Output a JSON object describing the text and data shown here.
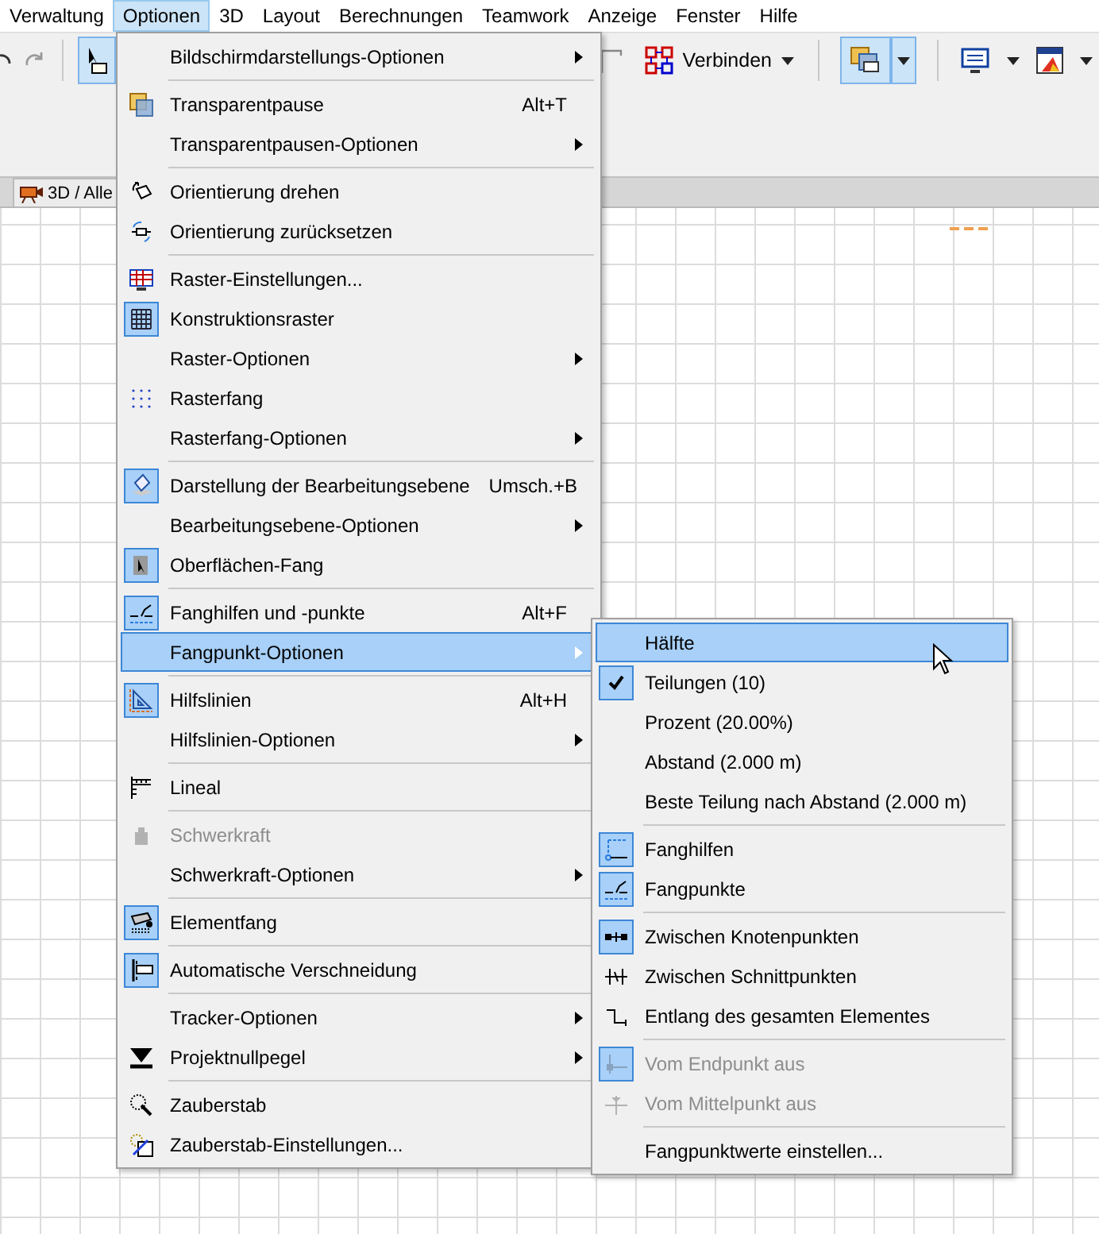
{
  "menubar": [
    {
      "label": "Verwaltung",
      "selected": false
    },
    {
      "label": "Optionen",
      "selected": true
    },
    {
      "label": "3D",
      "selected": false
    },
    {
      "label": "Layout",
      "selected": false
    },
    {
      "label": "Berechnungen",
      "selected": false
    },
    {
      "label": "Teamwork",
      "selected": false
    },
    {
      "label": "Anzeige",
      "selected": false
    },
    {
      "label": "Fenster",
      "selected": false
    },
    {
      "label": "Hilfe",
      "selected": false
    }
  ],
  "toolbar": {
    "connect_button": {
      "label": "Verbinden"
    }
  },
  "tab": {
    "label": "3D / Alle"
  },
  "menu": {
    "items": [
      {
        "kind": "item",
        "label": "Bildschirmdarstellungs-Optionen",
        "submenu": true,
        "checked": false,
        "disabled": false,
        "selected": false
      },
      {
        "kind": "separator"
      },
      {
        "kind": "item",
        "label": "Transparentpause",
        "shortcut": "Alt+T",
        "checked": false,
        "disabled": false,
        "selected": false
      },
      {
        "kind": "item",
        "label": "Transparentpausen-Optionen",
        "submenu": true,
        "checked": false,
        "disabled": false,
        "selected": false
      },
      {
        "kind": "separator"
      },
      {
        "kind": "item",
        "label": "Orientierung drehen",
        "checked": false,
        "disabled": false,
        "selected": false
      },
      {
        "kind": "item",
        "label": "Orientierung zurücksetzen",
        "checked": false,
        "disabled": false,
        "selected": false
      },
      {
        "kind": "separator"
      },
      {
        "kind": "item",
        "label": "Raster-Einstellungen...",
        "checked": false,
        "disabled": false,
        "selected": false
      },
      {
        "kind": "item",
        "label": "Konstruktionsraster",
        "checked": true,
        "disabled": false,
        "selected": false
      },
      {
        "kind": "item",
        "label": "Raster-Optionen",
        "submenu": true,
        "checked": false,
        "disabled": false,
        "selected": false
      },
      {
        "kind": "item",
        "label": "Rasterfang",
        "checked": false,
        "disabled": false,
        "selected": false
      },
      {
        "kind": "item",
        "label": "Rasterfang-Optionen",
        "submenu": true,
        "checked": false,
        "disabled": false,
        "selected": false
      },
      {
        "kind": "separator"
      },
      {
        "kind": "item",
        "label": "Darstellung der Bearbeitungsebene",
        "shortcut": "Umsch.+B",
        "checked": true,
        "disabled": false,
        "selected": false
      },
      {
        "kind": "item",
        "label": "Bearbeitungsebene-Optionen",
        "submenu": true,
        "checked": false,
        "disabled": false,
        "selected": false
      },
      {
        "kind": "item",
        "label": "Oberflächen-Fang",
        "checked": true,
        "disabled": false,
        "selected": false
      },
      {
        "kind": "separator"
      },
      {
        "kind": "item",
        "label": "Fanghilfen und -punkte",
        "shortcut": "Alt+F",
        "checked": true,
        "disabled": false,
        "selected": false
      },
      {
        "kind": "item",
        "label": "Fangpunkt-Optionen",
        "submenu": true,
        "checked": false,
        "disabled": false,
        "selected": true
      },
      {
        "kind": "separator"
      },
      {
        "kind": "item",
        "label": "Hilfslinien",
        "shortcut": "Alt+H",
        "checked": true,
        "disabled": false,
        "selected": false
      },
      {
        "kind": "item",
        "label": "Hilfslinien-Optionen",
        "submenu": true,
        "checked": false,
        "disabled": false,
        "selected": false
      },
      {
        "kind": "separator"
      },
      {
        "kind": "item",
        "label": "Lineal",
        "checked": false,
        "disabled": false,
        "selected": false
      },
      {
        "kind": "separator"
      },
      {
        "kind": "item",
        "label": "Schwerkraft",
        "checked": false,
        "disabled": true,
        "selected": false
      },
      {
        "kind": "item",
        "label": "Schwerkraft-Optionen",
        "submenu": true,
        "checked": false,
        "disabled": false,
        "selected": false
      },
      {
        "kind": "separator"
      },
      {
        "kind": "item",
        "label": "Elementfang",
        "checked": true,
        "disabled": false,
        "selected": false
      },
      {
        "kind": "separator"
      },
      {
        "kind": "item",
        "label": "Automatische Verschneidung",
        "checked": true,
        "disabled": false,
        "selected": false
      },
      {
        "kind": "separator"
      },
      {
        "kind": "item",
        "label": "Tracker-Optionen",
        "submenu": true,
        "checked": false,
        "disabled": false,
        "selected": false
      },
      {
        "kind": "item",
        "label": "Projektnullpegel",
        "submenu": true,
        "checked": false,
        "disabled": false,
        "selected": false
      },
      {
        "kind": "separator"
      },
      {
        "kind": "item",
        "label": "Zauberstab",
        "checked": false,
        "disabled": false,
        "selected": false
      },
      {
        "kind": "item",
        "label": "Zauberstab-Einstellungen...",
        "checked": false,
        "disabled": false,
        "selected": false
      }
    ]
  },
  "submenu": {
    "items": [
      {
        "kind": "item",
        "label": "Hälfte",
        "checked": false,
        "disabled": false,
        "selected": true
      },
      {
        "kind": "item",
        "label": "Teilungen (10)",
        "checked": true,
        "disabled": false,
        "selected": false
      },
      {
        "kind": "item",
        "label": "Prozent (20.00%)",
        "checked": false,
        "disabled": false,
        "selected": false
      },
      {
        "kind": "item",
        "label": "Abstand (2.000 m)",
        "checked": false,
        "disabled": false,
        "selected": false
      },
      {
        "kind": "item",
        "label": "Beste Teilung nach Abstand (2.000 m)",
        "checked": false,
        "disabled": false,
        "selected": false
      },
      {
        "kind": "separator"
      },
      {
        "kind": "item",
        "label": "Fanghilfen",
        "checked": true,
        "disabled": false,
        "selected": false
      },
      {
        "kind": "item",
        "label": "Fangpunkte",
        "checked": true,
        "disabled": false,
        "selected": false
      },
      {
        "kind": "separator"
      },
      {
        "kind": "item",
        "label": "Zwischen Knotenpunkten",
        "checked": true,
        "disabled": false,
        "selected": false
      },
      {
        "kind": "item",
        "label": "Zwischen Schnittpunkten",
        "checked": false,
        "disabled": false,
        "selected": false
      },
      {
        "kind": "item",
        "label": "Entlang des gesamten Elementes",
        "checked": false,
        "disabled": false,
        "selected": false
      },
      {
        "kind": "separator"
      },
      {
        "kind": "item",
        "label": "Vom Endpunkt aus",
        "checked": true,
        "disabled": true,
        "selected": false
      },
      {
        "kind": "item",
        "label": "Vom Mittelpunkt aus",
        "checked": false,
        "disabled": true,
        "selected": false
      },
      {
        "kind": "separator"
      },
      {
        "kind": "item",
        "label": "Fangpunktwerte einstellen...",
        "checked": false,
        "disabled": false,
        "selected": false
      }
    ]
  }
}
